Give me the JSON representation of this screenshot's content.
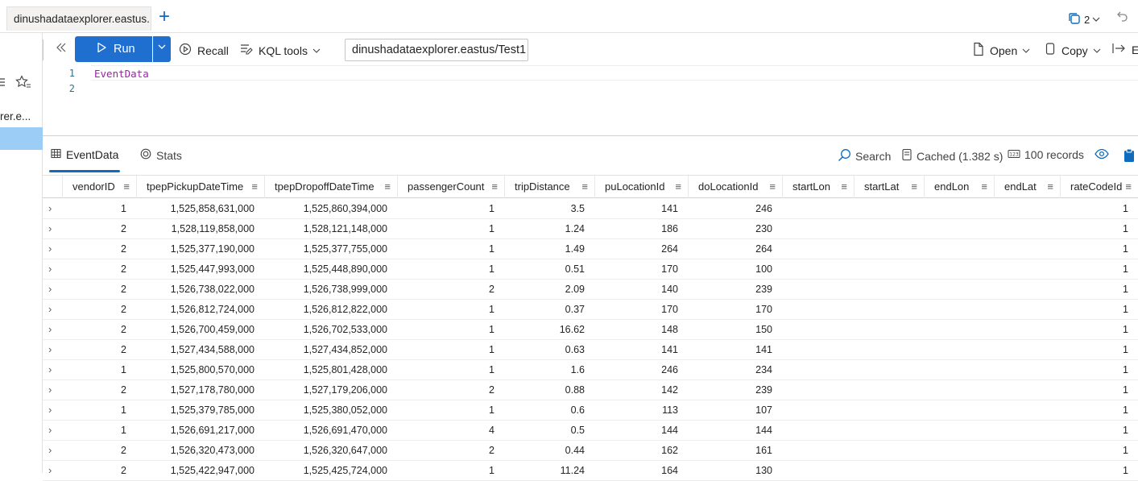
{
  "tab": {
    "title": "dinushadataexplorer.eastus...",
    "add_label": "+",
    "sessions": "2"
  },
  "sidebar": {
    "item_label": "rer.e..."
  },
  "toolbar": {
    "run_label": "Run",
    "recall_label": "Recall",
    "kql_tools_label": "KQL tools",
    "cluster_db": "dinushadataexplorer.eastus/Test1",
    "open_label": "Open",
    "copy_label": "Copy",
    "export_label": "E"
  },
  "editor": {
    "lines": [
      {
        "num": "1",
        "text": "EventData"
      },
      {
        "num": "2",
        "text": ""
      }
    ]
  },
  "results": {
    "tab_table": "EventData",
    "tab_stats": "Stats",
    "search_label": "Search",
    "cached_label": "Cached (1.382 s)",
    "records_label": "100 records",
    "columns": [
      "vendorID",
      "tpepPickupDateTime",
      "tpepDropoffDateTime",
      "passengerCount",
      "tripDistance",
      "puLocationId",
      "doLocationId",
      "startLon",
      "startLat",
      "endLon",
      "endLat",
      "rateCodeId"
    ],
    "rows": [
      [
        "1",
        "1,525,858,631,000",
        "1,525,860,394,000",
        "1",
        "3.5",
        "141",
        "246",
        "",
        "",
        "",
        "",
        "1"
      ],
      [
        "2",
        "1,528,119,858,000",
        "1,528,121,148,000",
        "1",
        "1.24",
        "186",
        "230",
        "",
        "",
        "",
        "",
        "1"
      ],
      [
        "2",
        "1,525,377,190,000",
        "1,525,377,755,000",
        "1",
        "1.49",
        "264",
        "264",
        "",
        "",
        "",
        "",
        "1"
      ],
      [
        "2",
        "1,525,447,993,000",
        "1,525,448,890,000",
        "1",
        "0.51",
        "170",
        "100",
        "",
        "",
        "",
        "",
        "1"
      ],
      [
        "2",
        "1,526,738,022,000",
        "1,526,738,999,000",
        "2",
        "2.09",
        "140",
        "239",
        "",
        "",
        "",
        "",
        "1"
      ],
      [
        "2",
        "1,526,812,724,000",
        "1,526,812,822,000",
        "1",
        "0.37",
        "170",
        "170",
        "",
        "",
        "",
        "",
        "1"
      ],
      [
        "2",
        "1,526,700,459,000",
        "1,526,702,533,000",
        "1",
        "16.62",
        "148",
        "150",
        "",
        "",
        "",
        "",
        "1"
      ],
      [
        "2",
        "1,527,434,588,000",
        "1,527,434,852,000",
        "1",
        "0.63",
        "141",
        "141",
        "",
        "",
        "",
        "",
        "1"
      ],
      [
        "1",
        "1,525,800,570,000",
        "1,525,801,428,000",
        "1",
        "1.6",
        "246",
        "234",
        "",
        "",
        "",
        "",
        "1"
      ],
      [
        "2",
        "1,527,178,780,000",
        "1,527,179,206,000",
        "2",
        "0.88",
        "142",
        "239",
        "",
        "",
        "",
        "",
        "1"
      ],
      [
        "1",
        "1,525,379,785,000",
        "1,525,380,052,000",
        "1",
        "0.6",
        "113",
        "107",
        "",
        "",
        "",
        "",
        "1"
      ],
      [
        "1",
        "1,526,691,217,000",
        "1,526,691,470,000",
        "4",
        "0.5",
        "144",
        "144",
        "",
        "",
        "",
        "",
        "1"
      ],
      [
        "2",
        "1,526,320,473,000",
        "1,526,320,647,000",
        "2",
        "0.44",
        "162",
        "161",
        "",
        "",
        "",
        "",
        "1"
      ],
      [
        "2",
        "1,525,422,947,000",
        "1,525,425,724,000",
        "1",
        "11.24",
        "164",
        "130",
        "",
        "",
        "",
        "",
        "1"
      ]
    ]
  },
  "colors": {
    "accent": "#0f6cbd",
    "run_button": "#1f6fd0",
    "selection": "#9ccdf6",
    "code_keyword": "#a21caf"
  }
}
